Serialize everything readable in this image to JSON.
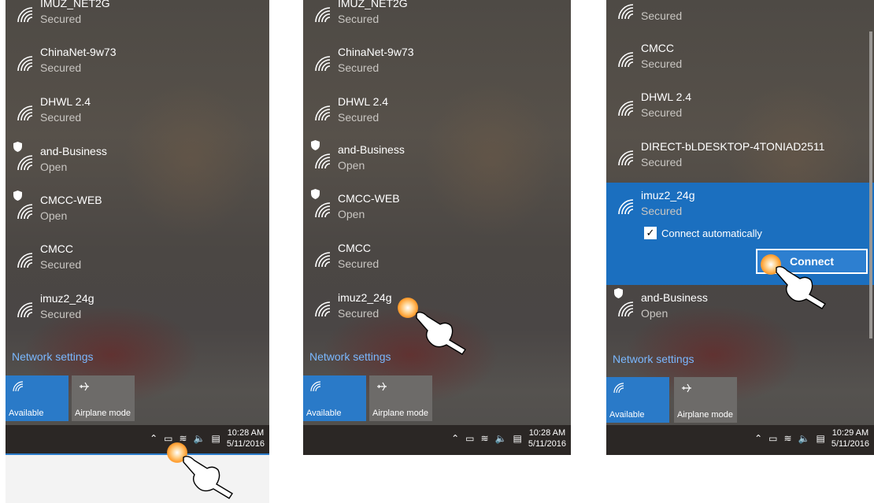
{
  "steps": [
    {
      "networks": [
        {
          "name": "IMUZ_NET2G",
          "status": "Secured",
          "shield": false
        },
        {
          "name": "ChinaNet-9w73",
          "status": "Secured",
          "shield": false
        },
        {
          "name": "DHWL 2.4",
          "status": "Secured",
          "shield": false
        },
        {
          "name": "and-Business",
          "status": "Open",
          "shield": true
        },
        {
          "name": "CMCC-WEB",
          "status": "Open",
          "shield": true
        },
        {
          "name": "CMCC",
          "status": "Secured",
          "shield": false
        },
        {
          "name": "imuz2_24g",
          "status": "Secured",
          "shield": false
        }
      ],
      "network_settings": "Network settings",
      "tiles": {
        "available": "Available",
        "airplane": "Airplane mode"
      },
      "clock": {
        "time": "10:28 AM",
        "date": "5/11/2016"
      },
      "hand_number": "1"
    },
    {
      "networks": [
        {
          "name": "IMUZ_NET2G",
          "status": "Secured",
          "shield": false
        },
        {
          "name": "ChinaNet-9w73",
          "status": "Secured",
          "shield": false
        },
        {
          "name": "DHWL 2.4",
          "status": "Secured",
          "shield": false
        },
        {
          "name": "and-Business",
          "status": "Open",
          "shield": true
        },
        {
          "name": "CMCC-WEB",
          "status": "Open",
          "shield": true
        },
        {
          "name": "CMCC",
          "status": "Secured",
          "shield": false
        },
        {
          "name": "imuz2_24g",
          "status": "Secured",
          "shield": false
        }
      ],
      "network_settings": "Network settings",
      "tiles": {
        "available": "Available",
        "airplane": "Airplane mode"
      },
      "clock": {
        "time": "10:28 AM",
        "date": "5/11/2016"
      },
      "hand_number": "2"
    },
    {
      "networks": [
        {
          "name": "",
          "status": "Secured",
          "shield": false
        },
        {
          "name": "CMCC",
          "status": "Secured",
          "shield": false
        },
        {
          "name": "DHWL 2.4",
          "status": "Secured",
          "shield": false
        },
        {
          "name": "DIRECT-bLDESKTOP-4TONIAD2511",
          "status": "Secured",
          "shield": false
        },
        {
          "name": "imuz2_24g",
          "status": "Secured",
          "shield": false,
          "selected": true
        },
        {
          "name": "and-Business",
          "status": "Open",
          "shield": true
        }
      ],
      "connect_automatically": "Connect automatically",
      "connect_button": "Connect",
      "network_settings": "Network settings",
      "tiles": {
        "available": "Available",
        "airplane": "Airplane mode"
      },
      "clock": {
        "time": "10:29 AM",
        "date": "5/11/2016"
      },
      "hand_number": "3"
    }
  ],
  "colors": {
    "accent": "#1b6fbf",
    "link": "#7ab8ff",
    "taskbar": "#2b2725",
    "touch": "#ff9d2e"
  }
}
